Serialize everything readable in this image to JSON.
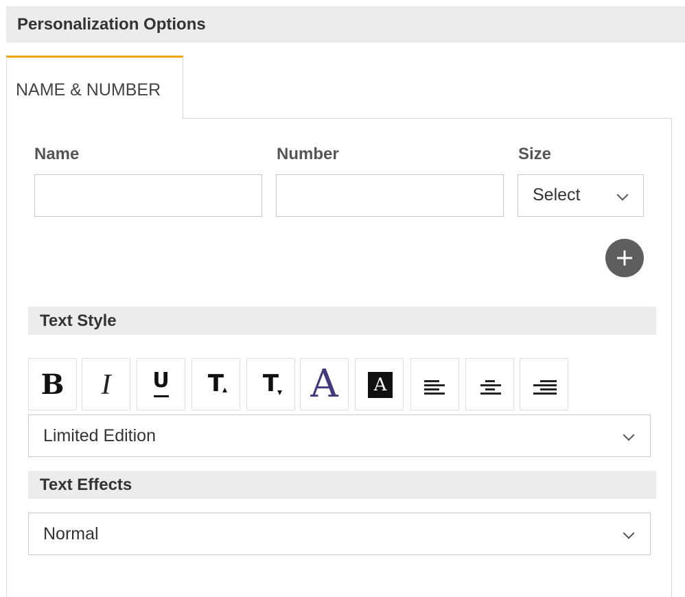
{
  "header": {
    "title": "Personalization Options"
  },
  "tabs": [
    {
      "label": "NAME & NUMBER",
      "active": true
    }
  ],
  "form": {
    "name_label": "Name",
    "name_value": "",
    "number_label": "Number",
    "number_value": "",
    "size_label": "Size",
    "size_value": "Select"
  },
  "add_button": {
    "icon": "plus-icon"
  },
  "text_style": {
    "title": "Text Style",
    "buttons": [
      {
        "name": "bold-button",
        "glyph": "B"
      },
      {
        "name": "italic-button",
        "glyph": "I"
      },
      {
        "name": "underline-button",
        "glyph": "U"
      },
      {
        "name": "superscript-button",
        "glyph": "T"
      },
      {
        "name": "subscript-button",
        "glyph": "T"
      },
      {
        "name": "font-color-button",
        "glyph": "A"
      },
      {
        "name": "background-color-button",
        "glyph": "A"
      },
      {
        "name": "align-left-button",
        "icon": "align-left-icon"
      },
      {
        "name": "align-center-button",
        "icon": "align-center-icon"
      },
      {
        "name": "align-right-button",
        "icon": "align-right-icon"
      }
    ],
    "font_value": "Limited Edition"
  },
  "text_effects": {
    "title": "Text Effects",
    "value": "Normal"
  },
  "colors": {
    "tab_accent": "#f0a500",
    "font_color_glyph": "#433a7e",
    "section_bg": "#ececec"
  }
}
